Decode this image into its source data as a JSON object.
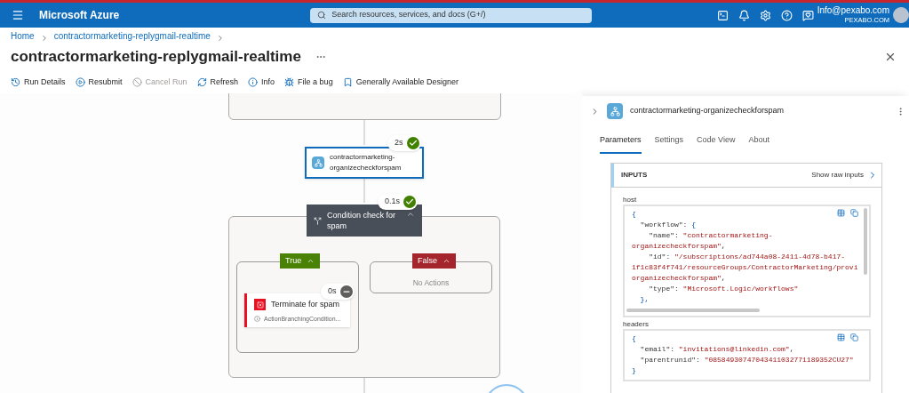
{
  "topbar": {
    "brand": "Microsoft Azure",
    "search": {
      "placeholder": "Search resources, services, and docs (G+/)"
    },
    "icons": [
      {
        "kind": "terminal"
      },
      {
        "kind": "bell"
      },
      {
        "kind": "settings"
      },
      {
        "kind": "help"
      },
      {
        "kind": "feedback"
      }
    ],
    "account": {
      "email": "Info@pexabo.com",
      "org": "PEXABO.COM"
    }
  },
  "breadcrumb": [
    "Home",
    "contractormarketing-replygmail-realtime"
  ],
  "title": "contractormarketing-replygmail-realtime",
  "toolbar": [
    {
      "label": "Run Details",
      "kind": "history",
      "disabled": false
    },
    {
      "label": "Resubmit",
      "kind": "resubmit",
      "disabled": false
    },
    {
      "label": "Cancel Run",
      "kind": "cancel",
      "disabled": true
    },
    {
      "label": "Refresh",
      "kind": "refresh",
      "disabled": false
    },
    {
      "label": "Info",
      "kind": "info",
      "disabled": false
    },
    {
      "label": "File a bug",
      "kind": "bug",
      "disabled": false
    },
    {
      "label": "Generally Available Designer",
      "kind": "bookmark",
      "disabled": false
    }
  ],
  "designer": {
    "action": {
      "name": "contractormarketing-organizecheckforspam",
      "duration": "2s",
      "kind": "succeeded",
      "selected": true
    },
    "condition": {
      "name": "Condition check for spam",
      "duration": "0.1s",
      "kind": "succeeded",
      "expanded": true
    },
    "branches": [
      {
        "label": "True",
        "kind": "true",
        "expanded": true,
        "actions": [
          {
            "name": "Terminate for spam",
            "note": "ActionBranchingCondition...",
            "duration": "0s",
            "kind": "skipped"
          }
        ]
      },
      {
        "label": "False",
        "kind": "false",
        "expanded": true,
        "empty_text": "No Actions"
      }
    ]
  },
  "panel": {
    "title": "contractormarketing-organizecheckforspam",
    "tabs": [
      {
        "label": "Parameters",
        "selected": true
      },
      {
        "label": "Settings",
        "selected": false
      },
      {
        "label": "Code View",
        "selected": false
      },
      {
        "label": "About",
        "selected": false
      }
    ],
    "inputs": {
      "heading": "INPUTS",
      "raw_link": "Show raw inputs",
      "fields": [
        {
          "label": "host",
          "scroll": true,
          "lines": [
            [
              {
                "t": "{",
                "kind": "brace"
              }
            ],
            [
              {
                "t": "  \"workflow\": ",
                "kind": "key"
              },
              {
                "t": "{",
                "kind": "brace"
              }
            ],
            [
              {
                "t": "    \"name\": ",
                "kind": "key"
              },
              {
                "t": "\"contractormarketing-",
                "kind": "string"
              }
            ],
            [
              {
                "t": "organizecheckforspam\"",
                "kind": "string"
              },
              {
                "t": ",",
                "kind": "punct"
              }
            ],
            [
              {
                "t": "    \"id\": ",
                "kind": "key"
              },
              {
                "t": "\"/subscriptions/ad744a08-2411-4d78-b417-",
                "kind": "string"
              }
            ],
            [
              {
                "t": "1f1c83f4f741/resourceGroups/ContractorMarketing/provi",
                "kind": "string"
              }
            ],
            [
              {
                "t": "organizecheckforspam\"",
                "kind": "string"
              },
              {
                "t": ",",
                "kind": "punct"
              }
            ],
            [
              {
                "t": "    \"type\": ",
                "kind": "key"
              },
              {
                "t": "\"Microsoft.Logic/workflows\"",
                "kind": "string"
              }
            ],
            [
              {
                "t": "  },",
                "kind": "brace"
              }
            ]
          ]
        },
        {
          "label": "headers",
          "scroll": false,
          "lines": [
            [
              {
                "t": "{",
                "kind": "brace"
              }
            ],
            [
              {
                "t": "  \"email\": ",
                "kind": "key"
              },
              {
                "t": "\"invitations@linkedin.com\"",
                "kind": "string"
              },
              {
                "t": ",",
                "kind": "punct"
              }
            ],
            [
              {
                "t": "  \"parentrunid\": ",
                "kind": "key"
              },
              {
                "t": "\"08584930747043411032771189352CU27\"",
                "kind": "string"
              }
            ],
            [
              {
                "t": "}",
                "kind": "brace"
              }
            ]
          ]
        }
      ]
    }
  }
}
